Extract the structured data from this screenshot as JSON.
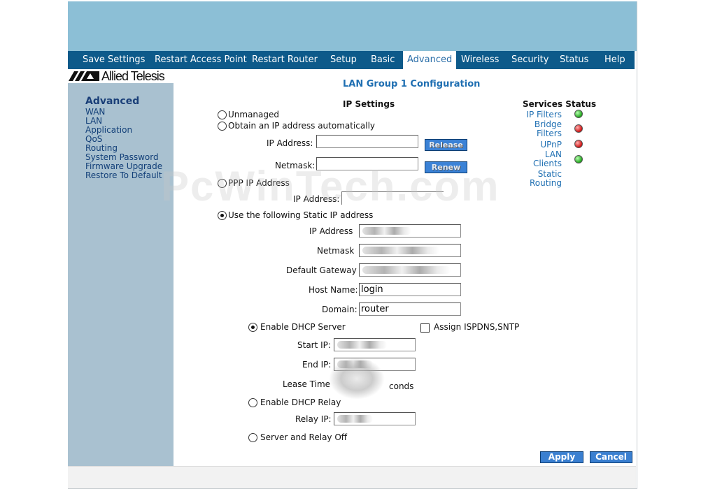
{
  "nav": {
    "items": [
      "Save Settings",
      "Restart Access Point",
      "Restart Router",
      "Setup",
      "Basic",
      "Advanced",
      "Wireless",
      "Security",
      "Status",
      "Help"
    ],
    "active": "Advanced"
  },
  "logo": {
    "text": "Allied Telesis"
  },
  "sidebar": {
    "title": "Advanced",
    "links": [
      "WAN",
      "LAN",
      "Application",
      "QoS",
      "Routing",
      "System Password",
      "Firmware Upgrade",
      "Restore To Default"
    ]
  },
  "page": {
    "title": "LAN Group 1 Configuration"
  },
  "ip_settings": {
    "heading": "IP Settings",
    "unmanaged": "Unmanaged",
    "obtain_auto": "Obtain an IP address automatically",
    "ip_address_label": "IP Address:",
    "netmask_label": "Netmask:",
    "release_button": "Release",
    "renew_button": "Renew",
    "ppp": "PPP IP Address",
    "ppp_ip_label": "IP Address:",
    "static": "Use the following Static IP address",
    "static_ip_label": "IP Address",
    "static_netmask_label": "Netmask",
    "gateway_label": "Default Gateway",
    "host_label": "Host Name:",
    "host_value": "login",
    "domain_label": "Domain:",
    "domain_value": "router",
    "selected": "static"
  },
  "dhcp": {
    "enable_server": "Enable DHCP Server",
    "assign_isp": "Assign ISPDNS,SNTP",
    "start_ip_label": "Start IP:",
    "end_ip_label": "End IP:",
    "lease_label": "Lease Time",
    "lease_suffix": "conds",
    "enable_relay": "Enable DHCP Relay",
    "relay_ip_label": "Relay IP:",
    "off": "Server and Relay Off",
    "selected": "server"
  },
  "services": {
    "heading": "Services Status",
    "items": [
      {
        "label": "IP Filters",
        "status": "green"
      },
      {
        "label": "Bridge Filters",
        "status": "red"
      },
      {
        "label": "UPnP",
        "status": "red"
      },
      {
        "label": "LAN Clients",
        "status": "green"
      },
      {
        "label": "Static Routing",
        "status": "none"
      }
    ]
  },
  "buttons": {
    "apply": "Apply",
    "cancel": "Cancel"
  },
  "watermark": "PcWinTech.com",
  "colors": {
    "nav": "#0d5a8a",
    "banner": "#8cbfd6",
    "sidebar": "#a9c1d0",
    "accent": "#1f6fb2"
  }
}
